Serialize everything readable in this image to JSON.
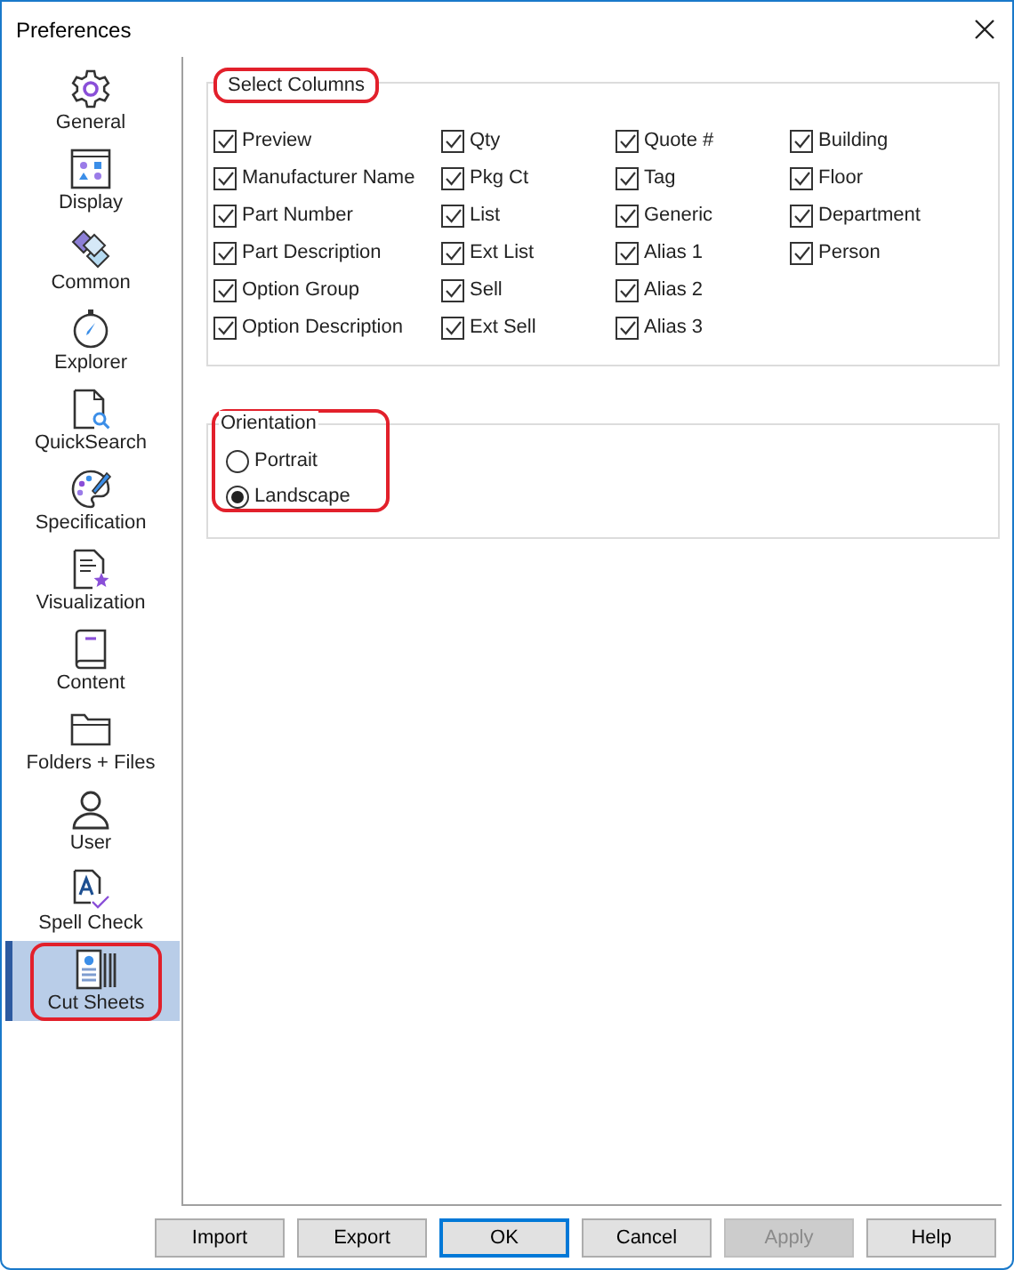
{
  "window": {
    "title": "Preferences"
  },
  "sidebar": {
    "items": [
      {
        "label": "General",
        "selected": false,
        "highlighted": false
      },
      {
        "label": "Display",
        "selected": false,
        "highlighted": false
      },
      {
        "label": "Common",
        "selected": false,
        "highlighted": false
      },
      {
        "label": "Explorer",
        "selected": false,
        "highlighted": false
      },
      {
        "label": "QuickSearch",
        "selected": false,
        "highlighted": false
      },
      {
        "label": "Specification",
        "selected": false,
        "highlighted": false
      },
      {
        "label": "Visualization",
        "selected": false,
        "highlighted": false
      },
      {
        "label": "Content",
        "selected": false,
        "highlighted": false
      },
      {
        "label": "Folders + Files",
        "selected": false,
        "highlighted": false
      },
      {
        "label": "User",
        "selected": false,
        "highlighted": false
      },
      {
        "label": "Spell Check",
        "selected": false,
        "highlighted": false
      },
      {
        "label": "Cut Sheets",
        "selected": true,
        "highlighted": true
      }
    ]
  },
  "select_columns": {
    "title": "Select Columns",
    "highlighted": true,
    "columns": [
      [
        {
          "label": "Preview",
          "checked": true
        },
        {
          "label": "Manufacturer Name",
          "checked": true
        },
        {
          "label": "Part Number",
          "checked": true
        },
        {
          "label": "Part Description",
          "checked": true
        },
        {
          "label": "Option Group",
          "checked": true
        },
        {
          "label": "Option Description",
          "checked": true
        }
      ],
      [
        {
          "label": "Qty",
          "checked": true
        },
        {
          "label": "Pkg Ct",
          "checked": true
        },
        {
          "label": "List",
          "checked": true
        },
        {
          "label": "Ext List",
          "checked": true
        },
        {
          "label": "Sell",
          "checked": true
        },
        {
          "label": "Ext Sell",
          "checked": true
        }
      ],
      [
        {
          "label": "Quote #",
          "checked": true
        },
        {
          "label": "Tag",
          "checked": true
        },
        {
          "label": "Generic",
          "checked": true
        },
        {
          "label": "Alias 1",
          "checked": true
        },
        {
          "label": "Alias 2",
          "checked": true
        },
        {
          "label": "Alias 3",
          "checked": true
        }
      ],
      [
        {
          "label": "Building",
          "checked": true
        },
        {
          "label": "Floor",
          "checked": true
        },
        {
          "label": "Department",
          "checked": true
        },
        {
          "label": "Person",
          "checked": true
        }
      ]
    ]
  },
  "orientation": {
    "title": "Orientation",
    "highlighted": true,
    "options": [
      {
        "label": "Portrait",
        "selected": false
      },
      {
        "label": "Landscape",
        "selected": true
      }
    ]
  },
  "buttons": [
    {
      "label": "Import",
      "default": false,
      "disabled": false
    },
    {
      "label": "Export",
      "default": false,
      "disabled": false
    },
    {
      "label": "OK",
      "default": true,
      "disabled": false
    },
    {
      "label": "Cancel",
      "default": false,
      "disabled": false
    },
    {
      "label": "Apply",
      "default": false,
      "disabled": true
    },
    {
      "label": "Help",
      "default": false,
      "disabled": false
    }
  ]
}
